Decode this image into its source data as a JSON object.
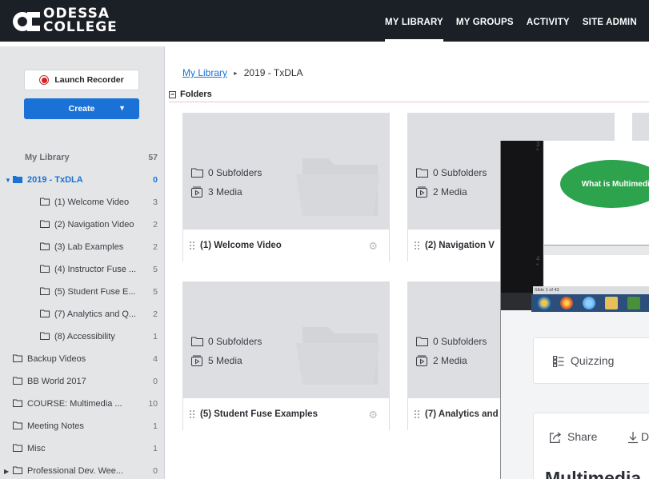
{
  "header": {
    "logo_line1": "ODESSA",
    "logo_line2": "COLLEGE",
    "nav": [
      "MY LIBRARY",
      "MY GROUPS",
      "ACTIVITY",
      "SITE ADMIN"
    ]
  },
  "sidebar": {
    "launch_recorder": "Launch Recorder",
    "create": "Create",
    "create_caret": "▼",
    "my_library": {
      "label": "My Library",
      "count": "57"
    },
    "items": [
      {
        "label": "2019 - TxDLA",
        "count": "0"
      },
      {
        "label": "(1) Welcome Video",
        "count": "3"
      },
      {
        "label": "(2) Navigation Video",
        "count": "2"
      },
      {
        "label": "(3) Lab Examples",
        "count": "2"
      },
      {
        "label": "(4) Instructor Fuse ...",
        "count": "5"
      },
      {
        "label": "(5) Student Fuse E...",
        "count": "5"
      },
      {
        "label": "(7) Analytics and Q...",
        "count": "2"
      },
      {
        "label": "(8) Accessibility",
        "count": "1"
      },
      {
        "label": "Backup Videos",
        "count": "4"
      },
      {
        "label": "BB World 2017",
        "count": "0"
      },
      {
        "label": "COURSE: Multimedia ...",
        "count": "10"
      },
      {
        "label": "Meeting Notes",
        "count": "1"
      },
      {
        "label": "Misc",
        "count": "1"
      },
      {
        "label": "Professional Dev. Wee...",
        "count": "0"
      }
    ]
  },
  "main": {
    "breadcrumb_link": "My Library",
    "breadcrumb_sep": "▸",
    "breadcrumb_current": "2019 - TxDLA",
    "folders_toggle": "−",
    "folders_heading": "Folders",
    "cards": [
      {
        "subfolders": "0 Subfolders",
        "media": "3 Media",
        "title": "(1) Welcome Video"
      },
      {
        "subfolders": "0 Subfolders",
        "media": "2 Media",
        "title": "(2) Navigation V"
      },
      {
        "subfolders": "0 Subfolders",
        "media": "5 Media",
        "title": "(5) Student Fuse Examples"
      },
      {
        "subfolders": "0 Subfolders",
        "media": "2 Media",
        "title": "(7) Analytics and"
      }
    ]
  },
  "overlay": {
    "slide_numbers": [
      "3",
      "4"
    ],
    "slide_marks": [
      "*",
      "*"
    ],
    "slide_text": "What is Multimedia",
    "ppt_status": "Slide 1 of 43",
    "quizzing": "Quizzing",
    "share": "Share",
    "download_partial": "D",
    "title_partial": "Multimedia"
  }
}
